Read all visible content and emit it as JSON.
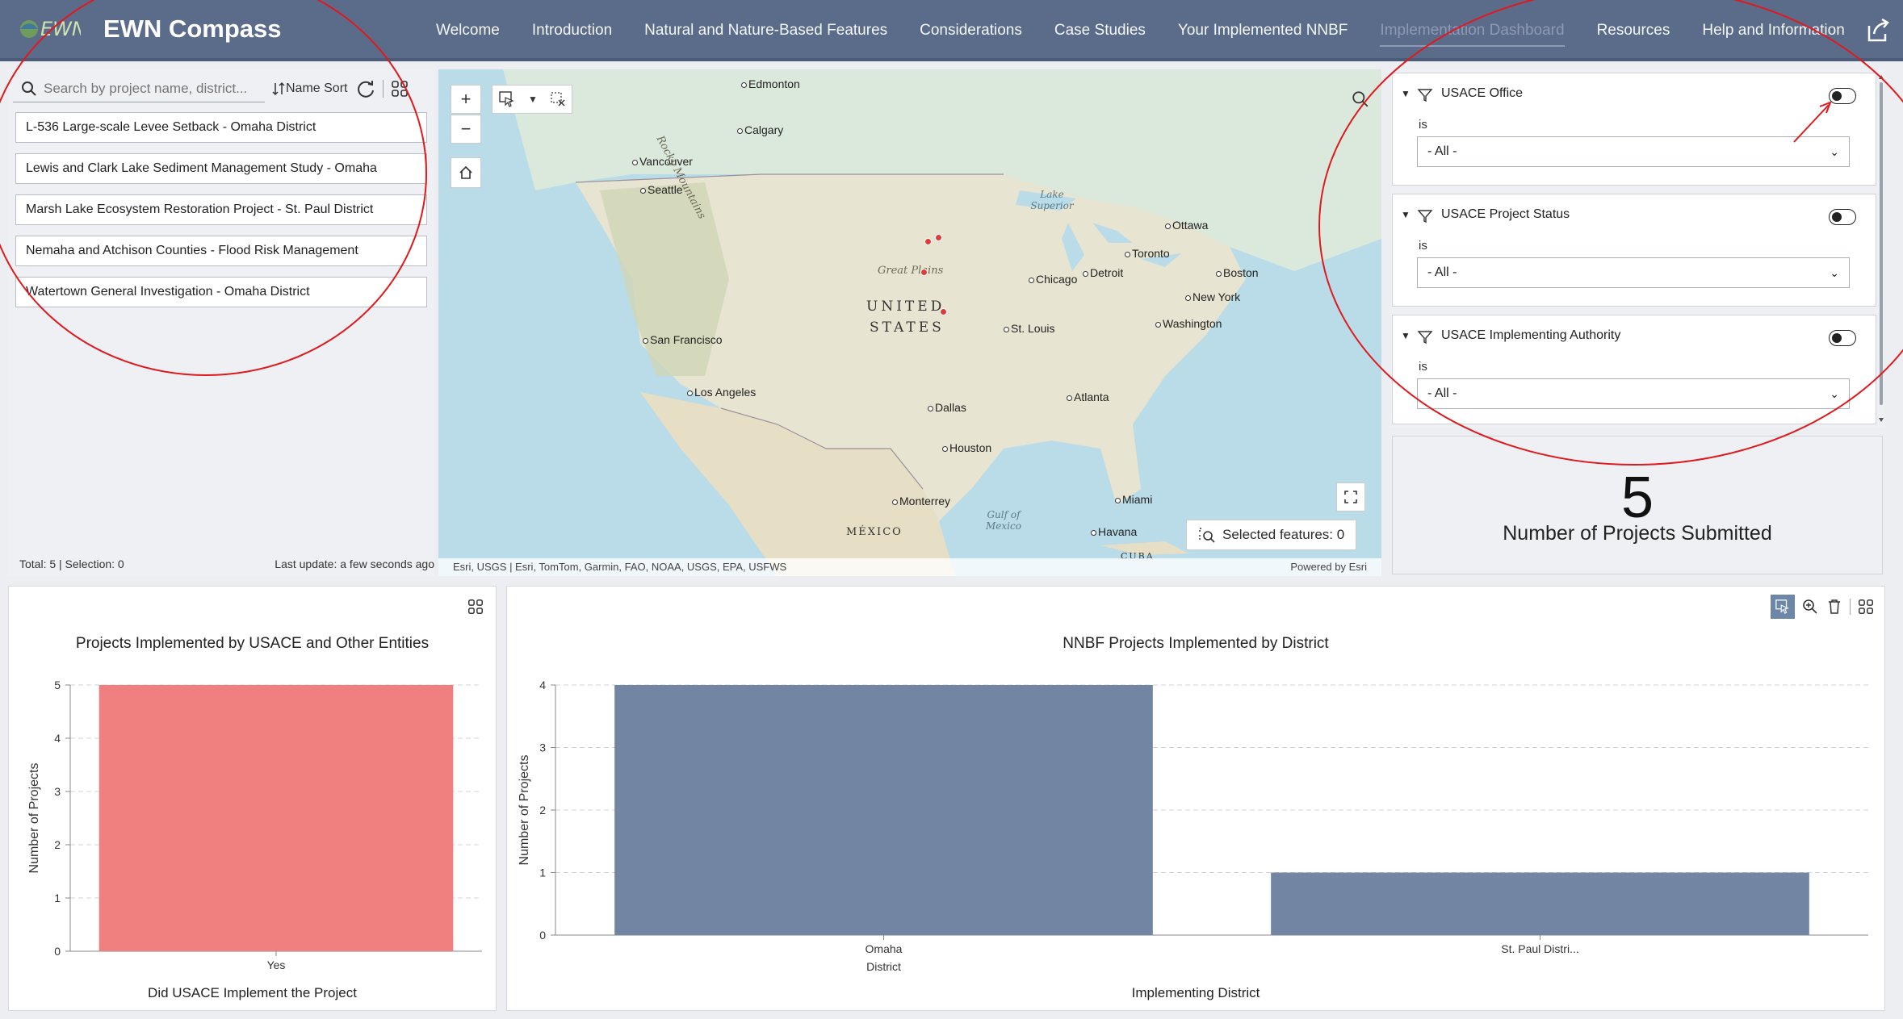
{
  "app": {
    "title": "EWN Compass",
    "logo_text": "EWN"
  },
  "nav": [
    "Welcome",
    "Introduction",
    "Natural and Nature-Based Features",
    "Considerations",
    "Case Studies",
    "Your Implemented NNBF",
    "Implementation Dashboard",
    "Resources",
    "Help and Information"
  ],
  "nav_active": "Implementation Dashboard",
  "list": {
    "search_placeholder": "Search by project name, district...",
    "sort_label": "Name Sort",
    "items": [
      "L-536 Large-scale Levee Setback  -  Omaha District",
      "Lewis and Clark Lake Sediment Management Study  -  Omaha",
      "Marsh Lake Ecosystem Restoration Project  -  St. Paul District",
      "Nemaha and Atchison Counties - Flood Risk Management",
      "Watertown General Investigation  -  Omaha District"
    ],
    "footer_left": "Total: 5 | Selection: 0",
    "footer_right": "Last update: a few seconds ago"
  },
  "map": {
    "attribution": "Esri, USGS | Esri, TomTom, Garmin, FAO, NOAA, USGS, EPA, USFWS",
    "powered_by": "Powered by Esri",
    "selected_features": "Selected features: 0",
    "country_label_1": "UNITED",
    "country_label_2": "STATES",
    "mexico_label": "MÉXICO",
    "cuba_label": "CUBA",
    "region_great_plains": "Great Plains",
    "region_rockies": "Rocky Mountains",
    "water_superior": "Lake Superior",
    "water_gulf": "Gulf of Mexico",
    "cities": {
      "edmonton": "Edmonton",
      "calgary": "Calgary",
      "vancouver": "Vancouver",
      "seattle": "Seattle",
      "ottawa": "Ottawa",
      "toronto": "Toronto",
      "detroit": "Detroit",
      "chicago": "Chicago",
      "boston": "Boston",
      "new_york": "New York",
      "washington": "Washington",
      "st_louis": "St. Louis",
      "san_francisco": "San Francisco",
      "los_angeles": "Los Angeles",
      "dallas": "Dallas",
      "atlanta": "Atlanta",
      "houston": "Houston",
      "monterrey": "Monterrey",
      "miami": "Miami",
      "havana": "Havana"
    }
  },
  "filters": [
    {
      "title": "USACE Office",
      "operator": "is",
      "value": "- All -"
    },
    {
      "title": "USACE Project Status",
      "operator": "is",
      "value": "- All -"
    },
    {
      "title": "USACE Implementing Authority",
      "operator": "is",
      "value": "- All -"
    }
  ],
  "kpi": {
    "value": "5",
    "label": "Number of Projects Submitted"
  },
  "colors": {
    "header": "#5b6b8a",
    "chart1_bar": "#f08080",
    "chart2_bar": "#7286a3",
    "annotation": "#e0191d"
  },
  "chart_data": [
    {
      "type": "bar",
      "title": "Projects Implemented by USACE and Other Entities",
      "xlabel": "Did USACE Implement the Project",
      "ylabel": "Number of Projects",
      "categories": [
        "Yes"
      ],
      "values": [
        5
      ],
      "ylim": [
        0,
        5
      ],
      "yticks": [
        "0",
        "1",
        "2",
        "3",
        "4",
        "5"
      ],
      "grid": true
    },
    {
      "type": "bar",
      "title": "NNBF Projects Implemented by District",
      "xlabel": "Implementing District",
      "ylabel": "Number of Projects",
      "categories": [
        "Omaha District",
        "St. Paul Distri..."
      ],
      "category_lines": [
        [
          "Omaha",
          "District"
        ],
        [
          "St. Paul Distri..."
        ]
      ],
      "values": [
        4,
        1
      ],
      "ylim": [
        0,
        4
      ],
      "yticks": [
        "0",
        "1",
        "2",
        "3",
        "4"
      ],
      "grid": true
    }
  ]
}
